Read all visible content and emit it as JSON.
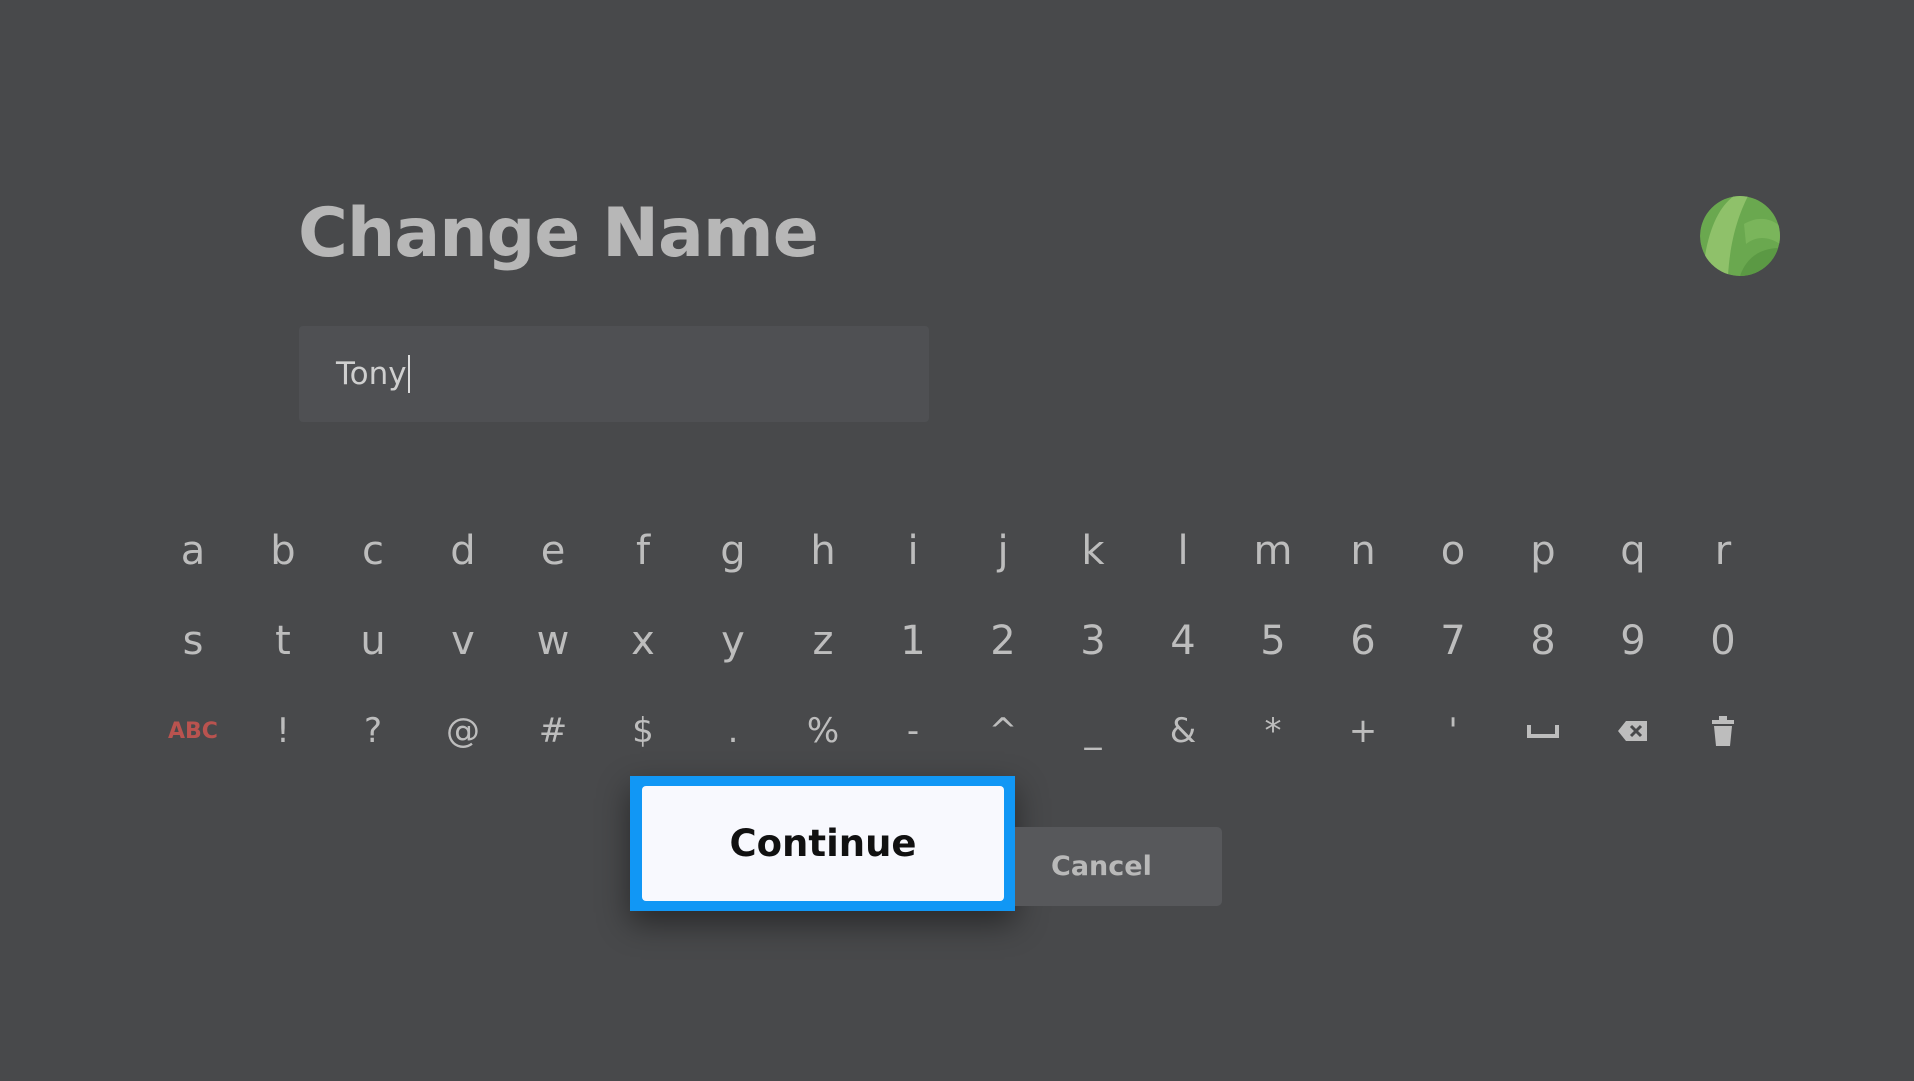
{
  "dialog": {
    "title": "Change Name",
    "name_field": {
      "value": "Tony"
    }
  },
  "keyboard": {
    "row1": [
      "a",
      "b",
      "c",
      "d",
      "e",
      "f",
      "g",
      "h",
      "i",
      "j",
      "k",
      "l",
      "m",
      "n",
      "o",
      "p",
      "q",
      "r"
    ],
    "row2": [
      "s",
      "t",
      "u",
      "v",
      "w",
      "x",
      "y",
      "z",
      "1",
      "2",
      "3",
      "4",
      "5",
      "6",
      "7",
      "8",
      "9",
      "0"
    ],
    "row3": {
      "mode_label": "ABC",
      "symbols": [
        "!",
        "?",
        "@",
        "#",
        "$",
        ".",
        "%",
        "-",
        "^",
        "_",
        "&",
        "*",
        "+",
        "'"
      ],
      "icons": [
        "space-icon",
        "backspace-icon",
        "trash-icon"
      ]
    }
  },
  "buttons": {
    "continue_label": "Continue",
    "cancel_label": "Cancel"
  },
  "colors": {
    "background": "#48494b",
    "focus_ring": "#1197f5",
    "abc_key": "#b9534f",
    "avatar": "#6aa84f"
  }
}
